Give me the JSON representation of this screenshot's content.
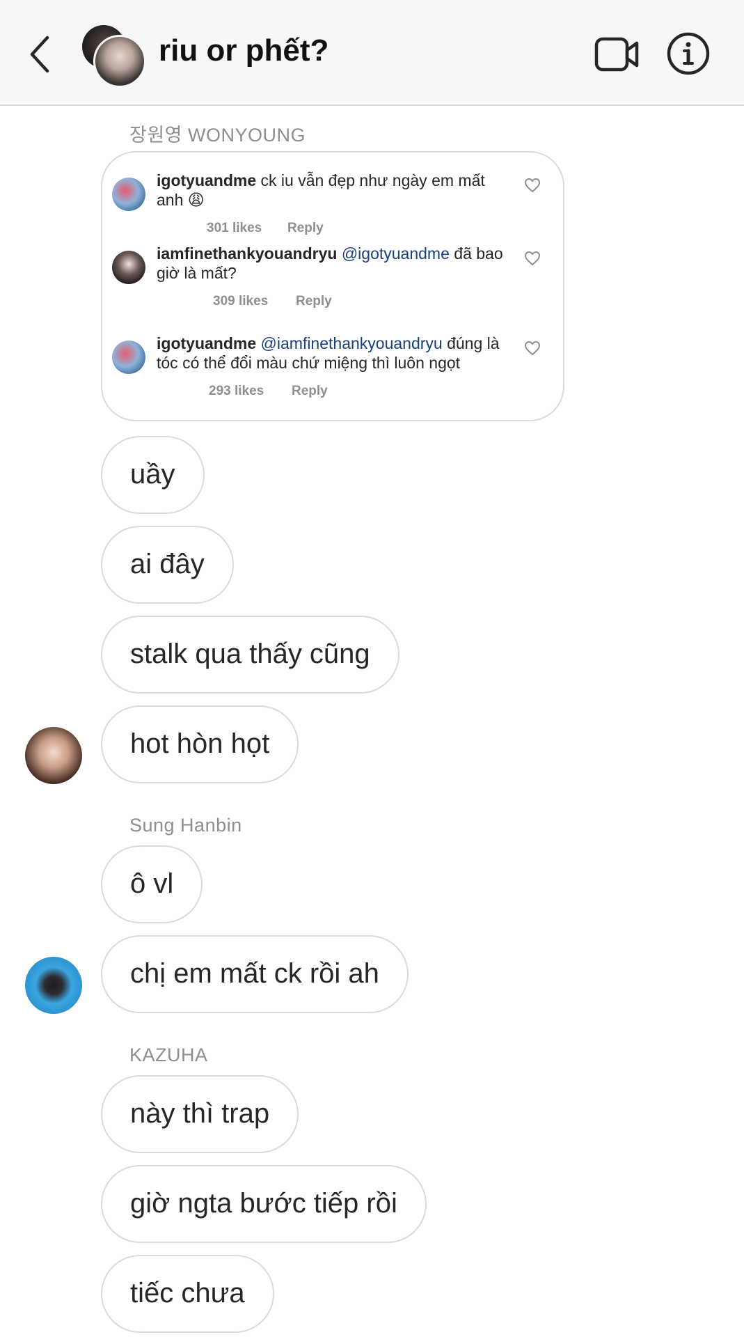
{
  "header": {
    "title": "riu or phết?",
    "back_icon": "chevron-left-icon",
    "video_icon": "video-camera-icon",
    "info_icon": "info-icon"
  },
  "shared_post": {
    "sender": "장원영 WONYOUNG",
    "comments": [
      {
        "user": "igotyuandme",
        "mention": "",
        "text": "ck iu vẫn đẹp như ngày em mất anh 😩",
        "likes": "301 likes",
        "reply": "Reply"
      },
      {
        "user": "iamfinethankyouandryu",
        "mention": "@igotyuandme",
        "text": "đã bao giờ là mất?",
        "likes": "309 likes",
        "reply": "Reply"
      },
      {
        "user": "igotyuandme",
        "mention": "@iamfinethankyouandryu",
        "text": "đúng là tóc có thể đổi màu chứ miệng thì luôn ngọt",
        "likes": "293 likes",
        "reply": "Reply"
      }
    ]
  },
  "groups": [
    {
      "sender": "",
      "messages": [
        "uầy",
        "ai đây",
        "stalk qua thấy cũng",
        "hot hòn họt"
      ]
    },
    {
      "sender": "Sung Hanbin",
      "messages": [
        "ô vl",
        "chị em mất ck rồi ah"
      ]
    },
    {
      "sender": "KAZUHA",
      "messages": [
        "này thì trap",
        "giờ ngta bước tiếp rồi",
        "tiếc chưa"
      ]
    }
  ],
  "colors": {
    "header_bg": "#f7f7f7",
    "bubble_border": "#dbdbdb",
    "muted_text": "#8e8e8e",
    "mention": "#1b3f7a"
  }
}
